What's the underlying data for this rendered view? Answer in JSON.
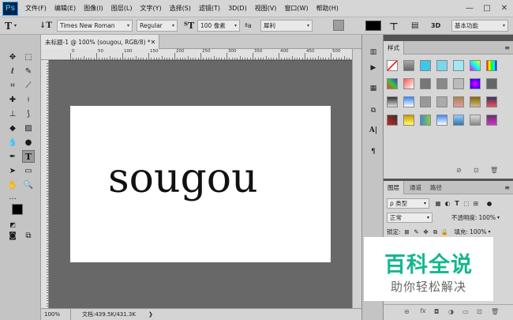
{
  "app": {
    "logo": "Ps"
  },
  "menu": [
    "文件(F)",
    "编辑(E)",
    "图像(I)",
    "图层(L)",
    "文字(Y)",
    "选择(S)",
    "滤镜(T)",
    "3D(D)",
    "视图(V)",
    "窗口(W)",
    "帮助(H)"
  ],
  "window_controls": {
    "minimize": "—",
    "maximize": "□",
    "close": "✕"
  },
  "options": {
    "tool_glyph": "T",
    "font_family": "Times New Roman",
    "font_style": "Regular",
    "font_size": "100 像素",
    "antialias": "犀利",
    "aa_label": "ªa",
    "threed_label": "3D",
    "workspace": "基本功能",
    "text_color": "#000000"
  },
  "document": {
    "tab_title": "未标题-1 @ 100% (sougou, RGB/8) *",
    "text": "sougou",
    "zoom": "100%",
    "doc_info": "文档:439.5K/431.3K"
  },
  "ruler": {
    "h_labels": [
      "0",
      "50",
      "100",
      "150",
      "200",
      "250",
      "300",
      "350",
      "400",
      "450",
      "500"
    ]
  },
  "styles_panel": {
    "tab": "样式"
  },
  "layers_panel": {
    "tabs": [
      "图层",
      "通道",
      "路径"
    ],
    "filter_kind": "ρ 类型",
    "blend_mode": "正常",
    "opacity_label": "不透明度:",
    "opacity_value": "100%",
    "lock_label": "锁定:",
    "fill_label": "填充:",
    "fill_value": "100%"
  },
  "watermark": {
    "line1": "百科全说",
    "line2": "助你轻松解决"
  },
  "colors": {
    "foreground": "#000000",
    "background": "#ffffff",
    "watermark_green": "#14b88d"
  }
}
